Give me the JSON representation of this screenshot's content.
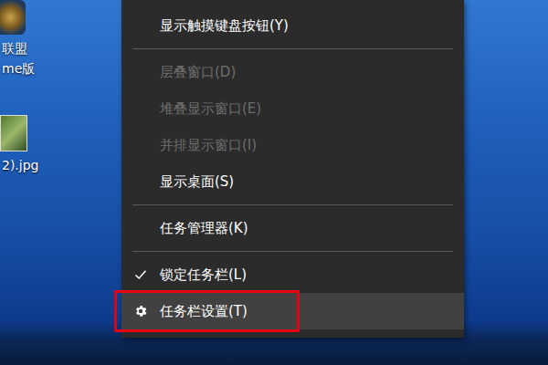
{
  "desktop": {
    "icons": [
      {
        "kind": "app",
        "label_lines": [
          "联盟",
          "me版"
        ]
      },
      {
        "kind": "image",
        "label_lines": [
          "2).jpg"
        ]
      }
    ]
  },
  "context_menu": {
    "items": [
      {
        "kind": "item",
        "label": "显示触摸键盘按钮(Y)",
        "disabled": false,
        "checked": false,
        "hovered": false,
        "annotated": false
      },
      {
        "kind": "separator"
      },
      {
        "kind": "item",
        "label": "层叠窗口(D)",
        "disabled": true,
        "checked": false,
        "hovered": false,
        "annotated": false
      },
      {
        "kind": "item",
        "label": "堆叠显示窗口(E)",
        "disabled": true,
        "checked": false,
        "hovered": false,
        "annotated": false
      },
      {
        "kind": "item",
        "label": "并排显示窗口(I)",
        "disabled": true,
        "checked": false,
        "hovered": false,
        "annotated": false
      },
      {
        "kind": "item",
        "label": "显示桌面(S)",
        "disabled": false,
        "checked": false,
        "hovered": false,
        "annotated": false
      },
      {
        "kind": "separator"
      },
      {
        "kind": "item",
        "label": "任务管理器(K)",
        "disabled": false,
        "checked": false,
        "hovered": false,
        "annotated": false
      },
      {
        "kind": "separator"
      },
      {
        "kind": "item",
        "label": "锁定任务栏(L)",
        "disabled": false,
        "checked": true,
        "hovered": false,
        "annotated": false
      },
      {
        "kind": "settings",
        "label": "任务栏设置(T)",
        "disabled": false,
        "checked": false,
        "hovered": true,
        "annotated": true
      }
    ]
  }
}
